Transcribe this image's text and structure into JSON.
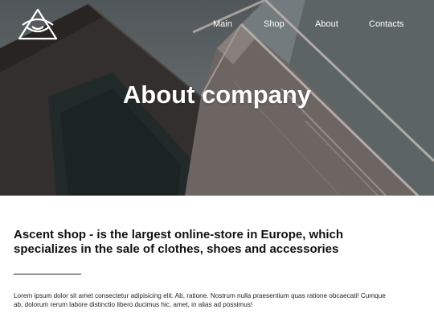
{
  "brand": {
    "logo_icon": "triangle-eye-logo-icon"
  },
  "nav": {
    "items": [
      "Main",
      "Shop",
      "About",
      "Contacts"
    ]
  },
  "hero": {
    "title": "About company"
  },
  "content": {
    "headline": "Ascent shop - is the largest online-store in Europe, which specializes in the sale of clothes, shoes and accessories",
    "paragraph": "Lorem ipsum dolor sit amet consectetur adipisicing elit. Ab, ratione. Nostrum nulla praesentium quas ratione obcaecati! Cumque ab, dolorum rerum labore distinctio libero ducimus hic, amet, in alias ad possimus!"
  },
  "colors": {
    "hero_text": "#ffffff",
    "page_bg": "#ffffff",
    "text": "#111111"
  }
}
